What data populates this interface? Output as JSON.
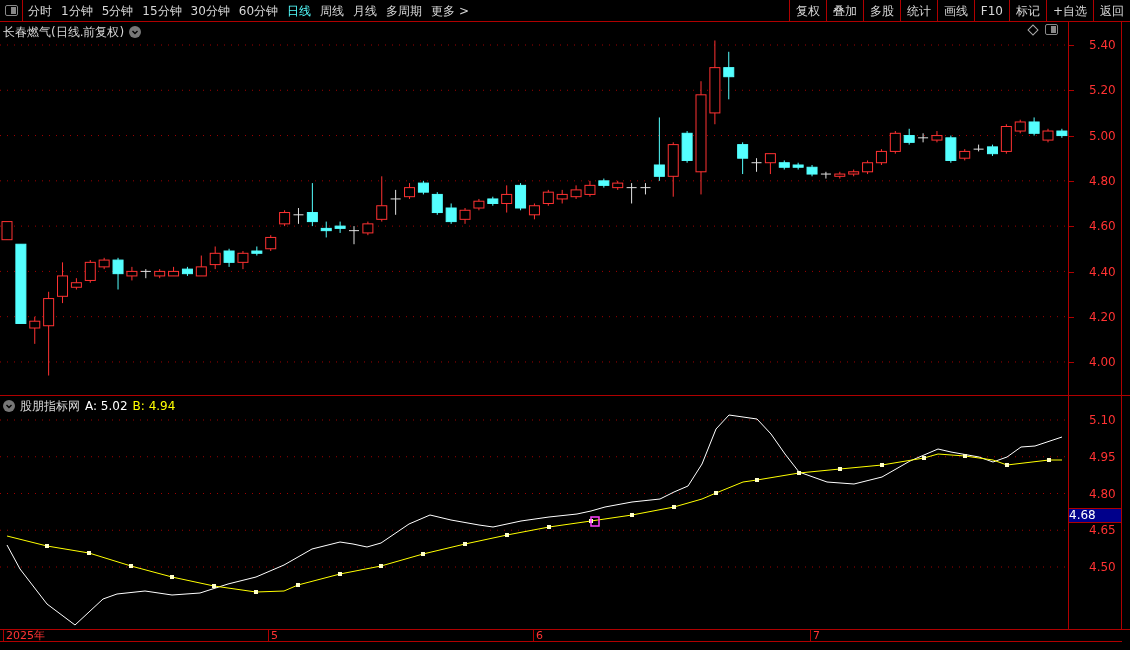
{
  "toolbar": {
    "periods": [
      {
        "label": "分时",
        "selected": false
      },
      {
        "label": "1分钟",
        "selected": false
      },
      {
        "label": "5分钟",
        "selected": false
      },
      {
        "label": "15分钟",
        "selected": false
      },
      {
        "label": "30分钟",
        "selected": false
      },
      {
        "label": "60分钟",
        "selected": false
      },
      {
        "label": "日线",
        "selected": true
      },
      {
        "label": "周线",
        "selected": false
      },
      {
        "label": "月线",
        "selected": false
      },
      {
        "label": "多周期",
        "selected": false
      },
      {
        "label": "更多 >",
        "selected": false
      }
    ],
    "actions": [
      "复权",
      "叠加",
      "多股",
      "统计",
      "画线",
      "F10",
      "标记",
      "+自选",
      "返回"
    ]
  },
  "price_chart": {
    "title": "长春燃气(日线.前复权)",
    "axis_labels": [
      "5.40",
      "5.20",
      "5.00",
      "4.80",
      "4.60",
      "4.40",
      "4.20",
      "4.00"
    ]
  },
  "indicator": {
    "name": "股朋指标网",
    "series": [
      {
        "text": "A: 5.02",
        "color": "#ffffff"
      },
      {
        "text": "B: 4.94",
        "color": "#ffff00"
      }
    ],
    "axis_labels": [
      "5.10",
      "4.95",
      "4.80",
      "4.65",
      "4.50"
    ],
    "cursor_value": "4.68"
  },
  "x_axis": {
    "labels": [
      "2025年",
      "5",
      "6",
      "7"
    ]
  }
}
